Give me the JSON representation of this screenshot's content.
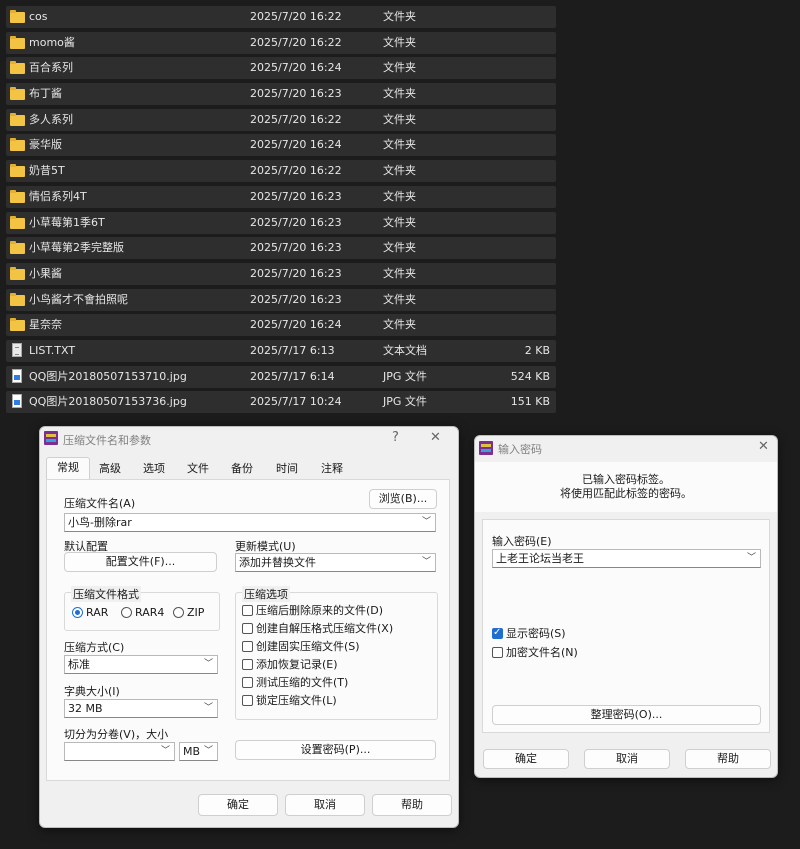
{
  "file_list": [
    {
      "icon": "folder-icon",
      "name": "cos",
      "date": "2025/7/20 16:22",
      "type": "文件夹",
      "size": ""
    },
    {
      "icon": "folder-icon",
      "name": "momo酱",
      "date": "2025/7/20 16:22",
      "type": "文件夹",
      "size": ""
    },
    {
      "icon": "folder-icon",
      "name": "百合系列",
      "date": "2025/7/20 16:24",
      "type": "文件夹",
      "size": ""
    },
    {
      "icon": "folder-icon",
      "name": "布丁酱",
      "date": "2025/7/20 16:23",
      "type": "文件夹",
      "size": ""
    },
    {
      "icon": "folder-icon",
      "name": "多人系列",
      "date": "2025/7/20 16:22",
      "type": "文件夹",
      "size": ""
    },
    {
      "icon": "folder-icon",
      "name": "豪华版",
      "date": "2025/7/20 16:24",
      "type": "文件夹",
      "size": ""
    },
    {
      "icon": "folder-icon",
      "name": "奶昔5T",
      "date": "2025/7/20 16:22",
      "type": "文件夹",
      "size": ""
    },
    {
      "icon": "folder-icon",
      "name": "情侣系列4T",
      "date": "2025/7/20 16:23",
      "type": "文件夹",
      "size": ""
    },
    {
      "icon": "folder-icon",
      "name": "小草莓第1季6T",
      "date": "2025/7/20 16:23",
      "type": "文件夹",
      "size": ""
    },
    {
      "icon": "folder-icon",
      "name": "小草莓第2季完整版",
      "date": "2025/7/20 16:23",
      "type": "文件夹",
      "size": ""
    },
    {
      "icon": "folder-icon",
      "name": "小果酱",
      "date": "2025/7/20 16:23",
      "type": "文件夹",
      "size": ""
    },
    {
      "icon": "folder-icon",
      "name": "小鸟酱才不會拍照呢",
      "date": "2025/7/20 16:23",
      "type": "文件夹",
      "size": ""
    },
    {
      "icon": "folder-icon",
      "name": "星奈奈",
      "date": "2025/7/20 16:24",
      "type": "文件夹",
      "size": ""
    },
    {
      "icon": "text-file-icon",
      "name": "LIST.TXT",
      "date": "2025/7/17 6:13",
      "type": "文本文档",
      "size": "2 KB"
    },
    {
      "icon": "image-file-icon",
      "name": "QQ图片20180507153710.jpg",
      "date": "2025/7/17 6:14",
      "type": "JPG 文件",
      "size": "524 KB"
    },
    {
      "icon": "image-file-icon",
      "name": "QQ图片20180507153736.jpg",
      "date": "2025/7/17 10:24",
      "type": "JPG 文件",
      "size": "151 KB"
    }
  ],
  "archive_dialog": {
    "title": "压缩文件名和参数",
    "help_glyph": "?",
    "close_glyph": "✕",
    "tabs": [
      "常规",
      "高级",
      "选项",
      "文件",
      "备份",
      "时间",
      "注释"
    ],
    "archive_name_label": "压缩文件名(A)",
    "browse_button": "浏览(B)...",
    "archive_name_value": "小鸟-删除rar",
    "default_profile_label": "默认配置",
    "profile_button": "配置文件(F)...",
    "update_mode_label": "更新模式(U)",
    "update_mode_value": "添加并替换文件",
    "format_group_label": "压缩文件格式",
    "format_options": [
      "RAR",
      "RAR4",
      "ZIP"
    ],
    "format_selected": "RAR",
    "method_label": "压缩方式(C)",
    "method_value": "标准",
    "dict_label": "字典大小(I)",
    "dict_value": "32 MB",
    "split_label": "切分为分卷(V)，大小",
    "split_value": "",
    "split_unit": "MB",
    "options_group_label": "压缩选项",
    "options": [
      {
        "label": "压缩后删除原来的文件(D)",
        "checked": false
      },
      {
        "label": "创建自解压格式压缩文件(X)",
        "checked": false
      },
      {
        "label": "创建固实压缩文件(S)",
        "checked": false
      },
      {
        "label": "添加恢复记录(E)",
        "checked": false
      },
      {
        "label": "测试压缩的文件(T)",
        "checked": false
      },
      {
        "label": "锁定压缩文件(L)",
        "checked": false
      }
    ],
    "set_password_button": "设置密码(P)...",
    "ok_button": "确定",
    "cancel_button": "取消",
    "help_button": "帮助"
  },
  "password_dialog": {
    "title": "输入密码",
    "close_glyph": "✕",
    "info_line1": "已输入密码标签。",
    "info_line2": "将使用匹配此标签的密码。",
    "password_label": "输入密码(E)",
    "password_value": "上老王论坛当老王",
    "show_password_label": "显示密码(S)",
    "show_password_checked": true,
    "encrypt_names_label": "加密文件名(N)",
    "encrypt_names_checked": false,
    "organize_button": "整理密码(O)...",
    "ok_button": "确定",
    "cancel_button": "取消",
    "help_button": "帮助"
  },
  "colors": {
    "background": "#1c1c1c",
    "row": "#2e2e2e",
    "folder": "#f3c344",
    "dialog": "#f0f0f0",
    "accent": "#1f6fd0"
  }
}
